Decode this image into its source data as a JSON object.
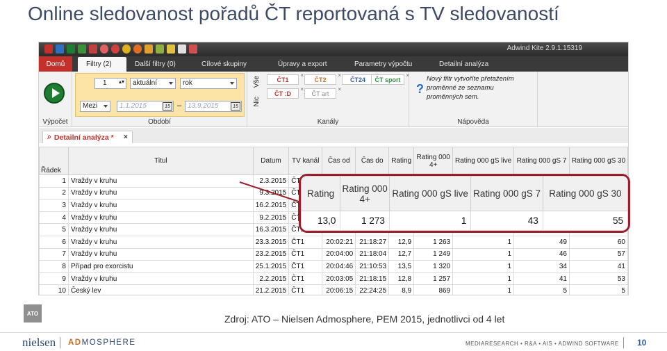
{
  "slide": {
    "title": "Online sledovanost pořadů ČT reportovaná s TV sledovaností",
    "source": "Zdroj: ATO – Nielsen Admosphere, PEM 2015, jednotlivci od 4 let",
    "source_logo": "ATO",
    "page_number": "10"
  },
  "footer": {
    "brand": "nielsen",
    "partner_ad": "AD",
    "partner_rest": "MOSPHERE",
    "right": "MEDIARESEARCH • R&A • AIS • ADWIND SOFTWARE"
  },
  "app": {
    "title": "Adwind Kite 2.9.1.15319",
    "tabs": [
      "Domů",
      "Filtry (2)",
      "Další filtry (0)",
      "Cílové skupiny",
      "Úpravy a export",
      "Parametry výpočtu",
      "Detailní analýza"
    ],
    "active_tab": "Filtry (2)",
    "groups": {
      "vypocet": "Výpočet",
      "obdobi": "Období",
      "kanaly": "Kanály",
      "napoveda": "Nápověda"
    },
    "obdobi": {
      "count": "1",
      "mode": "aktuální",
      "unit": "rok",
      "range_type": "Mezi",
      "date_from": "1.1.2015",
      "date_to": "13.9.2015",
      "dash": "–",
      "cal_icon": "15"
    },
    "channels": {
      "all_label": "Vše",
      "none_label": "Nic",
      "items": [
        "ČT1",
        "ČT2",
        "ČT24",
        "ČT sport",
        "ČT :D",
        "ČT art"
      ]
    },
    "help": {
      "icon": "?",
      "text": "Nový filtr vytvoříte přetažením proměnné ze seznamu proměnných sem."
    },
    "document_tab": "Detailní analýza *",
    "document_tab_close": "×"
  },
  "grid": {
    "headers": {
      "radek": "Řádek",
      "titul": "Titul",
      "datum": "Datum",
      "kanal": "TV kanál",
      "od": "Čas od",
      "do": "Čas do",
      "rating": "Rating",
      "r4": "Rating 000 4+",
      "live": "Rating 000 gS live",
      "s7": "Rating 000 gS 7",
      "s30": "Rating 000 gS 30"
    },
    "rows": [
      [
        "1",
        "Vraždy v kruhu",
        "2.3.2015",
        "ČT1",
        "",
        "",
        "",
        "",
        "",
        "",
        ""
      ],
      [
        "2",
        "Vraždy v kruhu",
        "9.3.2015",
        "ČT1",
        "",
        "",
        "",
        "",
        "",
        "",
        ""
      ],
      [
        "3",
        "Vraždy v kruhu",
        "16.2.2015",
        "ČT1",
        "",
        "",
        "",
        "",
        "",
        "",
        ""
      ],
      [
        "4",
        "Vraždy v kruhu",
        "9.2.2015",
        "ČT1",
        "",
        "",
        "",
        "",
        "",
        "",
        ""
      ],
      [
        "5",
        "Vraždy v kruhu",
        "16.3.2015",
        "ČT1",
        "",
        "",
        "",
        "",
        "",
        "",
        ""
      ],
      [
        "6",
        "Vraždy v kruhu",
        "23.3.2015",
        "ČT1",
        "20:02:21",
        "21:18:27",
        "12,9",
        "1 263",
        "1",
        "49",
        "60"
      ],
      [
        "7",
        "Vraždy v kruhu",
        "23.2.2015",
        "ČT1",
        "20:04:00",
        "21:18:04",
        "12,7",
        "1 249",
        "1",
        "46",
        "57"
      ],
      [
        "8",
        "Případ pro exorcistu",
        "25.1.2015",
        "ČT1",
        "20:04:46",
        "21:10:53",
        "13,5",
        "1 320",
        "1",
        "34",
        "41"
      ],
      [
        "9",
        "Vraždy v kruhu",
        "2.2.2015",
        "ČT1",
        "20:03:05",
        "21:18:15",
        "12,8",
        "1 257",
        "1",
        "41",
        "53"
      ],
      [
        "10",
        "Český lev",
        "21.2.2015",
        "ČT1",
        "20:06:15",
        "22:24:25",
        "8,9",
        "869",
        "1",
        "5",
        "5"
      ]
    ]
  },
  "zoom": {
    "headers": [
      "Rating",
      "Rating 000 4+",
      "Rating 000 gS live",
      "Rating 000 gS 7",
      "Rating 000 gS 30"
    ],
    "values": [
      "13,0",
      "1 273",
      "1",
      "43",
      "55"
    ]
  },
  "colors": {
    "home_tab": "#c4302b",
    "callout_border": "#9c1f2b",
    "filter_panel": "#fbe4a6",
    "play_button": "#1e7d33"
  }
}
